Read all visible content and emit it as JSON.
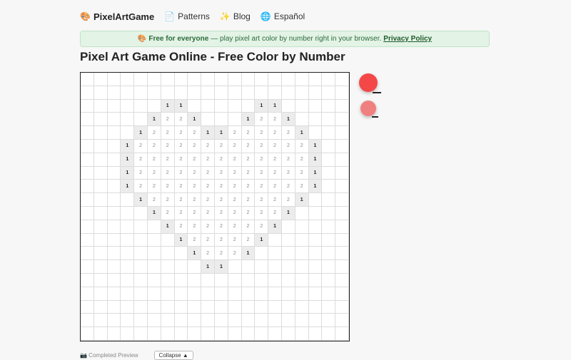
{
  "nav": {
    "brand": {
      "icon": "🎨",
      "label": "PixelArtGame"
    },
    "items": [
      {
        "icon": "📄",
        "label": "Patterns"
      },
      {
        "icon": "✨",
        "label": "Blog"
      },
      {
        "icon": "🌐",
        "label": "Español"
      }
    ]
  },
  "banner": {
    "icon": "🎨",
    "strong": "Free for everyone",
    "text": "— play pixel art color by number right in your browser.",
    "link": "Privacy Policy"
  },
  "title": "Pixel Art Game Online - Free Color by Number",
  "board": {
    "columns": 20,
    "rows": [
      "....................",
      "....................",
      "......11.....11.....",
      ".....1221...1221....",
      "....1222211222221...",
      "...122222222222221..",
      "...122222222222221..",
      "...122222222222221..",
      "...122222222222221..",
      "....1222222222221...",
      ".....12222222221....",
      "......122222221.....",
      ".......1222221......",
      "........12221.......",
      ".........11.........",
      "....................",
      "....................",
      "....................",
      "....................",
      "...................."
    ]
  },
  "palette": [
    {
      "number": 1,
      "color": "#f44848",
      "selected": true
    },
    {
      "number": 2,
      "color": "#f08080",
      "selected": false
    }
  ],
  "footer": {
    "label": "📷 Completed Preview",
    "collapse_label": "Collapse ▲"
  }
}
